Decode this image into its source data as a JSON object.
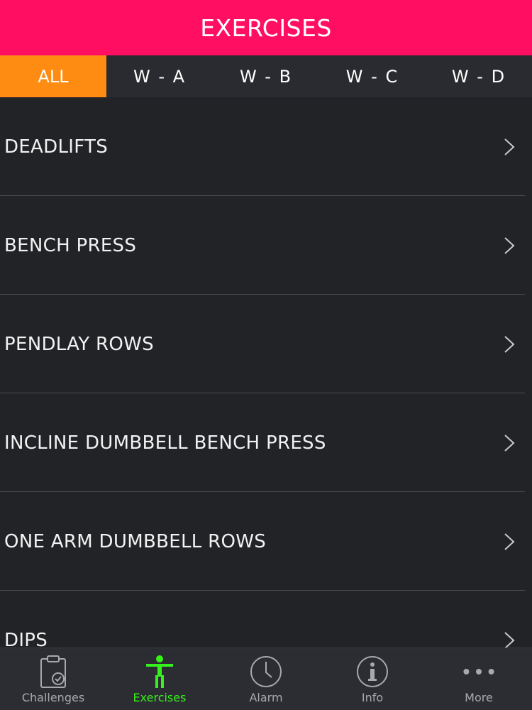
{
  "header": {
    "title": "EXERCISES"
  },
  "filter_tabs": [
    {
      "label": "ALL",
      "active": true
    },
    {
      "label": "W - A",
      "active": false
    },
    {
      "label": "W - B",
      "active": false
    },
    {
      "label": "W - C",
      "active": false
    },
    {
      "label": "W - D",
      "active": false
    }
  ],
  "exercises": [
    {
      "name": "DEADLIFTS"
    },
    {
      "name": "BENCH PRESS"
    },
    {
      "name": "PENDLAY ROWS"
    },
    {
      "name": "INCLINE DUMBBELL BENCH PRESS"
    },
    {
      "name": "ONE ARM DUMBBELL ROWS"
    },
    {
      "name": "DIPS"
    }
  ],
  "tabbar": [
    {
      "label": "Challenges",
      "icon": "clipboard-check-icon",
      "active": false
    },
    {
      "label": "Exercises",
      "icon": "person-icon",
      "active": true
    },
    {
      "label": "Alarm",
      "icon": "clock-icon",
      "active": false
    },
    {
      "label": "Info",
      "icon": "info-icon",
      "active": false
    },
    {
      "label": "More",
      "icon": "more-dots-icon",
      "active": false
    }
  ],
  "colors": {
    "header": "#ff0e62",
    "active_filter": "#ff8c12",
    "active_tab": "#35f21a",
    "background": "#222327"
  }
}
